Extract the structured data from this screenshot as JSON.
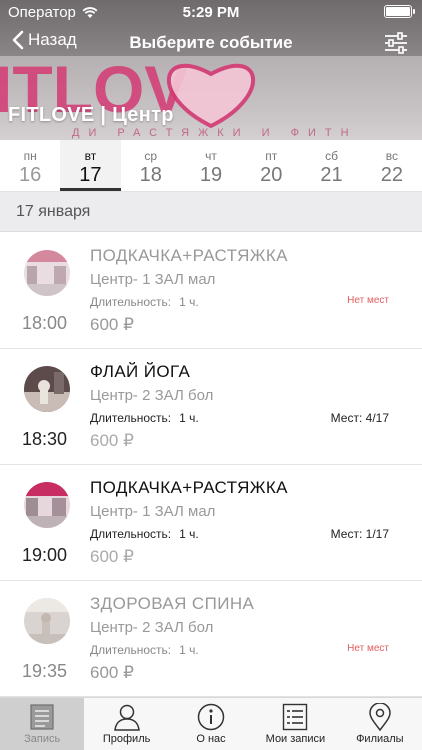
{
  "status": {
    "carrier": "Оператор",
    "time": "5:29 PM"
  },
  "nav": {
    "back_label": "Назад",
    "title": "Выберите событие"
  },
  "banner": {
    "title": "FITLOVE | Центр",
    "logo_text": "ITLOV",
    "tagline": "ДИ РАСТЯЖКИ И ФИТН"
  },
  "days": [
    {
      "dow": "пн",
      "num": "16"
    },
    {
      "dow": "вт",
      "num": "17"
    },
    {
      "dow": "ср",
      "num": "18"
    },
    {
      "dow": "чт",
      "num": "19"
    },
    {
      "dow": "пт",
      "num": "20"
    },
    {
      "dow": "сб",
      "num": "21"
    },
    {
      "dow": "вс",
      "num": "22"
    }
  ],
  "selected_day": "17",
  "section_date": "17 января",
  "duration_label": "Длительность:",
  "events": [
    {
      "name": "ПОДКАЧКА+РАСТЯЖКА",
      "place": "Центр- 1 ЗАЛ мал",
      "duration": "1 ч.",
      "seats": "Нет мест",
      "time": "18:00",
      "price": "600 ₽",
      "full": true
    },
    {
      "name": "ФЛАЙ ЙОГА",
      "place": "Центр- 2 ЗАЛ бол",
      "duration": "1 ч.",
      "seats": "Мест: 4/17",
      "time": "18:30",
      "price": "600 ₽",
      "full": false
    },
    {
      "name": "ПОДКАЧКА+РАСТЯЖКА",
      "place": "Центр- 1 ЗАЛ мал",
      "duration": "1 ч.",
      "seats": "Мест: 1/17",
      "time": "19:00",
      "price": "600 ₽",
      "full": false
    },
    {
      "name": "ЗДОРОВАЯ СПИНА",
      "place": "Центр- 2 ЗАЛ бол",
      "duration": "1 ч.",
      "seats": "Нет мест",
      "time": "19:35",
      "price": "600 ₽",
      "full": true
    }
  ],
  "tabs": [
    {
      "label": "Запись",
      "icon": "calendar-list-icon",
      "active": true
    },
    {
      "label": "Профиль",
      "icon": "person-icon",
      "active": false
    },
    {
      "label": "О нас",
      "icon": "info-icon",
      "active": false
    },
    {
      "label": "Мои записи",
      "icon": "list-icon",
      "active": false
    },
    {
      "label": "Филиалы",
      "icon": "map-pin-icon",
      "active": false
    }
  ],
  "colors": {
    "accent": "#333333",
    "no_seats": "#e35d5d",
    "brand_pink": "#d9336e"
  }
}
